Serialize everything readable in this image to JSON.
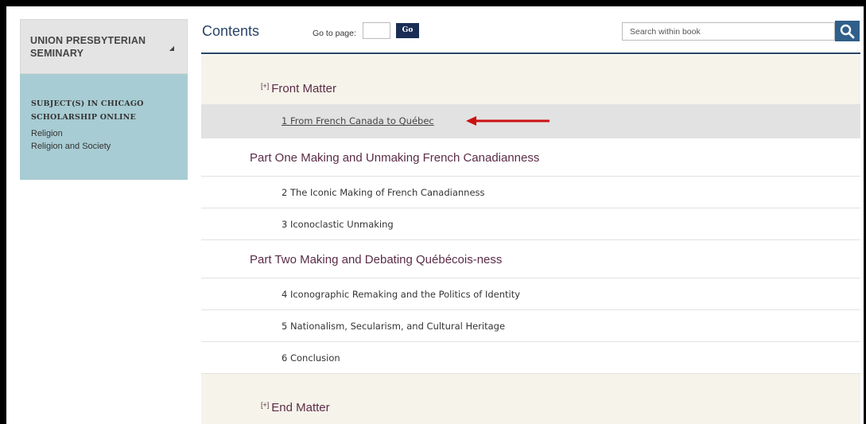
{
  "sidebar": {
    "institution": "UNION PRESBYTERIAN SEMINARY",
    "caret": "◢",
    "subjects_heading": "SUBJECT(S) IN CHICAGO SCHOLARSHIP ONLINE",
    "subjects": [
      "Religion",
      "Religion and Society"
    ]
  },
  "header": {
    "title": "Contents",
    "goto_label": "Go to page:",
    "goto_value": "",
    "go_button": "Go",
    "search_placeholder": "Search within book",
    "search_icon": "search-icon"
  },
  "toc": {
    "plus": "[+]",
    "front_matter": "Front Matter",
    "chapter1": "1 From French Canada to Québec",
    "part1": "Part One Making and Unmaking French Canadianness",
    "chapter2": "2 The Iconic Making of French Canadianness",
    "chapter3": "3 Iconoclastic Unmaking",
    "part2": "Part Two Making and Debating Québécois-ness",
    "chapter4": "4 Iconographic Remaking and the Politics of Identity",
    "chapter5": "5 Nationalism, Secularism, and Cultural Heritage",
    "chapter6": "6 Conclusion",
    "end_matter": "End Matter"
  },
  "colors": {
    "accent_navy": "#1a2d55",
    "title_blue": "#2b4568",
    "part_plum": "#5b2c47",
    "sidebar_teal": "#a8ccd3",
    "annotation_arrow": "#cc1111"
  }
}
